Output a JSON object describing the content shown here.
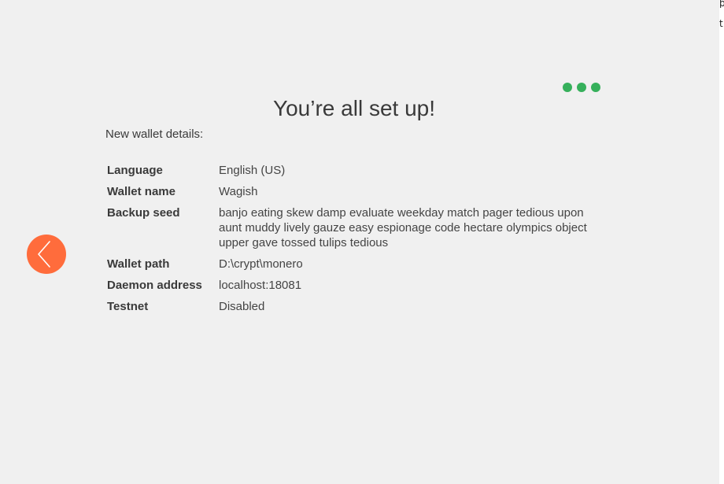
{
  "title": "You’re all set up!",
  "subtitle": "New wallet details:",
  "progress": {
    "steps_completed": 3,
    "total_steps": 3,
    "color": "#36b05b"
  },
  "back_button": {
    "icon": "chevron-left-icon",
    "color": "#ff6c3c"
  },
  "details": [
    {
      "label": "Language",
      "value": "English (US)"
    },
    {
      "label": "Wallet name",
      "value": "Wagish"
    },
    {
      "label": "Backup seed",
      "value": "banjo eating skew damp evaluate weekday match pager tedious upon aunt muddy lively gauze easy espionage code hectare olympics object upper gave tossed tulips tedious"
    },
    {
      "label": "Wallet path",
      "value": "D:\\crypt\\monero"
    },
    {
      "label": "Daemon address",
      "value": "localhost:18081"
    },
    {
      "label": "Testnet",
      "value": "Disabled"
    }
  ]
}
